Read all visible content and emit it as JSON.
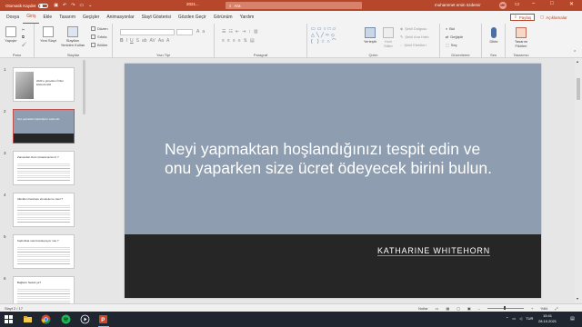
{
  "titlebar": {
    "autosave_label": "Otomatik Kaydet",
    "doc_title": "2021...",
    "search_placeholder": "Ara",
    "user_name": "muhammet emin özdemir",
    "user_initials": "ME",
    "minimize": "–",
    "maximize": "□",
    "close": "✕"
  },
  "menu": {
    "tabs": [
      "Dosya",
      "Giriş",
      "Ekle",
      "Tasarım",
      "Geçişler",
      "Animasyonlar",
      "Slayt Gösterisi",
      "Gözden Geçir",
      "Görünüm",
      "Yardım"
    ],
    "share_label": "Paylaş",
    "comments_label": "Açıklamalar"
  },
  "ribbon": {
    "clipboard": {
      "label": "Pano",
      "paste": "Yapıştır"
    },
    "slides": {
      "label": "Slaytlar",
      "new_slide": "Yeni Slayt",
      "reuse_slides": "Slaytları Yeniden Kullan",
      "layout": "Düzen",
      "reset": "Sıfırla",
      "section": "Bölüm"
    },
    "font": {
      "label": "Yazı Tipi"
    },
    "paragraph": {
      "label": "Paragraf"
    },
    "drawing": {
      "label": "Çizim",
      "arrange": "Yerleştir",
      "quick_styles": "Hızlı Stiller",
      "shape_fill": "Şekil Dolgusu",
      "shape_outline": "Şekil Ana Hattı",
      "shape_effects": "Şekil Efektleri"
    },
    "editing": {
      "label": "Düzenleme",
      "find": "Bul",
      "replace": "Değiştir",
      "select": "Seç"
    },
    "voice": {
      "label": "Ses",
      "dictate": "Dikte"
    },
    "designer": {
      "label": "Tasarımcı",
      "design_ideas": "Tasarım Fikirleri"
    }
  },
  "thumbnails": [
    {
      "number": "1",
      "title": "2021'e göre/den Örtler kılavuzundd"
    },
    {
      "number": "2",
      "title": "Neyi yapmaktan hoşlandığınızı tespit edin"
    },
    {
      "number": "3",
      "title": "Zamandan Ders Çıkaramazsınız ?"
    },
    {
      "number": "4",
      "title": "Alkolden harekete etmeleleme nasıl ?"
    },
    {
      "number": "5",
      "title": "Kadınlıkta nasıl kısılaşmıyor nas ?"
    },
    {
      "number": "6",
      "title": "Bağlantı Nedeli ya?"
    }
  ],
  "slide": {
    "quote": "Neyi yapmaktan hoşlandığınızı tespit edin ve onu yaparken size ücret ödeyecek birini bulun.",
    "author": "KATHARINE WHITEHORN"
  },
  "statusbar": {
    "slide_info": "Slayt 2 / 17",
    "notes": "Notlar",
    "zoom": "%84"
  },
  "taskbar": {
    "time": "15:41",
    "date": "28.10.2021",
    "language": "TUR"
  },
  "colors": {
    "accent": "#b7472a",
    "slide_bg": "#8e9eb0",
    "slide_band": "#262626"
  }
}
